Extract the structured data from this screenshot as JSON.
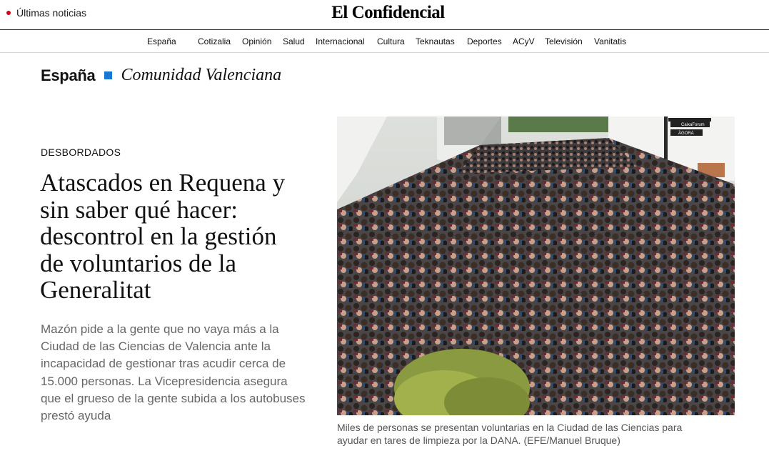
{
  "header": {
    "breaking_label": "Últimas noticias",
    "logo": "El Confidencial",
    "accent_color": "#d0021b"
  },
  "nav": {
    "items": [
      "España",
      "Cotizalia",
      "Opinión",
      "Salud",
      "Internacional",
      "Cultura",
      "Teknautas",
      "Deportes",
      "ACyV",
      "Televisión",
      "Vanitatis"
    ]
  },
  "breadcrumb": {
    "section": "España",
    "subsection": "Comunidad Valenciana",
    "marker_color": "#1877d2"
  },
  "article": {
    "kicker": "DESBORDADOS",
    "headline_lines": [
      "Atascados en Requena y",
      "sin saber qué hacer:",
      "descontrol en la gestión",
      "de voluntarios de la",
      "Generalitat"
    ],
    "summary_lines": [
      "Mazón pide a la gente que no vaya más a la",
      "Ciudad de las Ciencias de Valencia ante la",
      "incapacidad de gestionar tras acudir cerca de",
      "15.000 personas. La Vicepresidencia asegura",
      "que el grueso de la gente subida a los autobuses",
      "prestó ayuda"
    ]
  },
  "photo": {
    "caption_lines": [
      "Miles de personas se presentan voluntarias en la Ciudad de las Ciencias para",
      "ayudar en tares de limpieza por la DANA. (EFE/Manuel Bruque)"
    ],
    "signs": [
      "CaixaForum",
      "ÀGORA"
    ]
  }
}
